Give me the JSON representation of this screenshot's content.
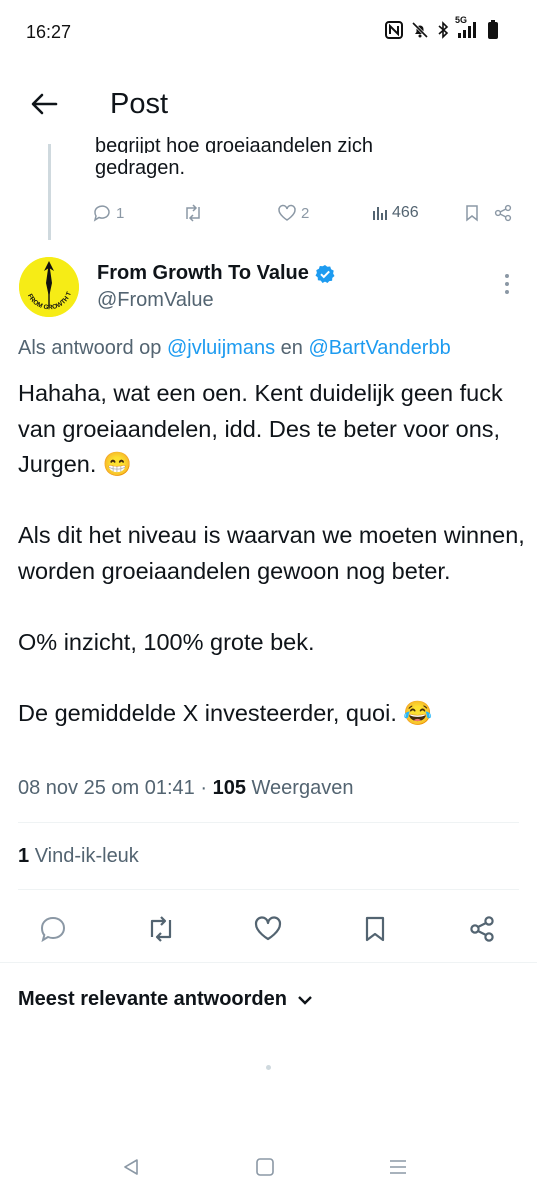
{
  "status": {
    "time": "16:27",
    "network": "5G",
    "icons": [
      "nfc-icon",
      "bell-off-icon",
      "bluetooth-icon",
      "signal-icon",
      "battery-icon"
    ]
  },
  "header": {
    "title": "Post"
  },
  "previous_post": {
    "text_clipped": "begrijpt hoe groeiaandelen zich",
    "text_line2": "gedragen.",
    "replies": "1",
    "reposts": "",
    "likes": "2",
    "views": "466"
  },
  "post": {
    "author_name": "From Growth To Value",
    "author_handle": "@FromValue",
    "verified": true,
    "avatar_text": "FROM GROWTH TO VALUE",
    "reply_prefix": "Als antwoord op",
    "reply_mention_1": "@jvluijmans",
    "reply_joiner": "en",
    "reply_mention_2": "@BartVanderbb",
    "paragraphs": [
      "Hahaha, wat een oen. Kent duidelijk geen fuck van groeiaandelen, idd. Des te beter voor ons, Jurgen. 😁",
      "Als dit het niveau is waarvan we moeten winnen, worden groeiaandelen gewoon nog beter.",
      "O% inzicht, 100% grote bek.",
      "De gemiddelde X investeerder, quoi. 😂"
    ],
    "timestamp": "08 nov 25 om 01:41",
    "separator": "·",
    "views_count": "105",
    "views_label": "Weergaven",
    "likes_count": "1",
    "likes_label": "Vind-ik-leuk"
  },
  "sort": {
    "label": "Meest relevante antwoorden"
  },
  "colors": {
    "accent": "#1d9bf0",
    "text": "#0f1419",
    "muted": "#536471",
    "avatar_bg": "#f6ec16"
  }
}
